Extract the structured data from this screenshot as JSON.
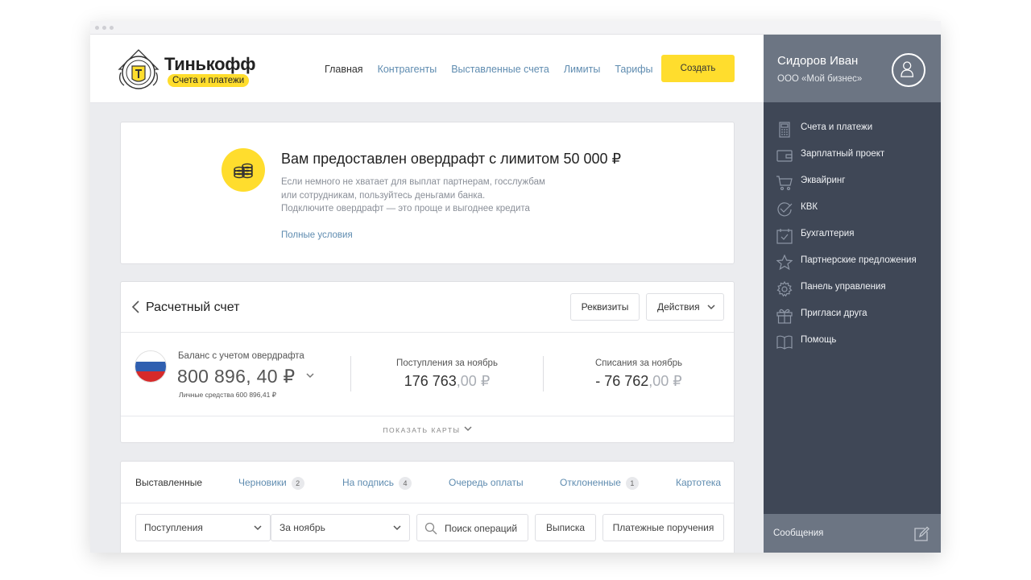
{
  "header": {
    "brand": "Тинькофф",
    "brand_sub": "Счета и платежи",
    "nav": [
      "Главная",
      "Контрагенты",
      "Выставленные счета",
      "Лимиты",
      "Тарифы"
    ],
    "create_label": "Создать"
  },
  "promo": {
    "title": "Вам предоставлен овердрафт с лимитом 50 000 ₽",
    "line1": "Если немного не хватает для выплат партнерам, госслужбам",
    "line2": "или сотрудникам, пользуйтесь деньгами банка.",
    "line3": "Подключите овердрафт — это проще и выгоднее кредита",
    "link": "Полные условия"
  },
  "account": {
    "title": "Расчетный счет",
    "requisites_label": "Реквизиты",
    "actions_label": "Действия",
    "balance_label": "Баланс с учетом овердрафта",
    "balance_value": "800 896, 40 ₽",
    "personal_funds": "Личные средства 600 896,41 ₽",
    "income_label": "Поступления за ноябрь",
    "income_main": "176 763",
    "income_cents": ",00 ₽",
    "expense_label": "Списания за ноябрь",
    "expense_main": "- 76 762",
    "expense_cents": ",00 ₽",
    "show_cards": "ПОКАЗАТЬ КАРТЫ"
  },
  "operations": {
    "tabs": [
      {
        "label": "Выставленные",
        "badge": ""
      },
      {
        "label": "Черновики",
        "badge": "2"
      },
      {
        "label": "На подпись",
        "badge": "4"
      },
      {
        "label": "Очередь оплаты",
        "badge": ""
      },
      {
        "label": "Отклоненные",
        "badge": "1"
      },
      {
        "label": "Картотека",
        "badge": ""
      }
    ],
    "filter_type": "Поступления",
    "filter_period": "За ноябрь",
    "search_placeholder": "Поиск операций",
    "statement_label": "Выписка",
    "payment_orders_label": "Платежные поручения"
  },
  "sidebar": {
    "user_name": "Сидоров Иван",
    "org": "ООО «Мой бизнес»",
    "items": [
      {
        "label": "Счета и платежи",
        "icon": "calculator-icon"
      },
      {
        "label": "Зарплатный проект",
        "icon": "wallet-icon"
      },
      {
        "label": "Эквайринг",
        "icon": "cart-icon"
      },
      {
        "label": "КВК",
        "icon": "check-circle-icon"
      },
      {
        "label": "Бухгалтерия",
        "icon": "calendar-check-icon"
      },
      {
        "label": "Партнерские предложения",
        "icon": "star-icon"
      },
      {
        "label": "Панель управления",
        "icon": "gear-icon"
      },
      {
        "label": "Пригласи друга",
        "icon": "gift-icon"
      },
      {
        "label": "Помощь",
        "icon": "book-icon"
      }
    ],
    "messages_label": "Сообщения"
  },
  "colors": {
    "accent_yellow": "#ffdd2d",
    "sidebar_dark": "#3f4756",
    "sidebar_light": "#6c7583",
    "link_blue": "#5f8cb0"
  }
}
